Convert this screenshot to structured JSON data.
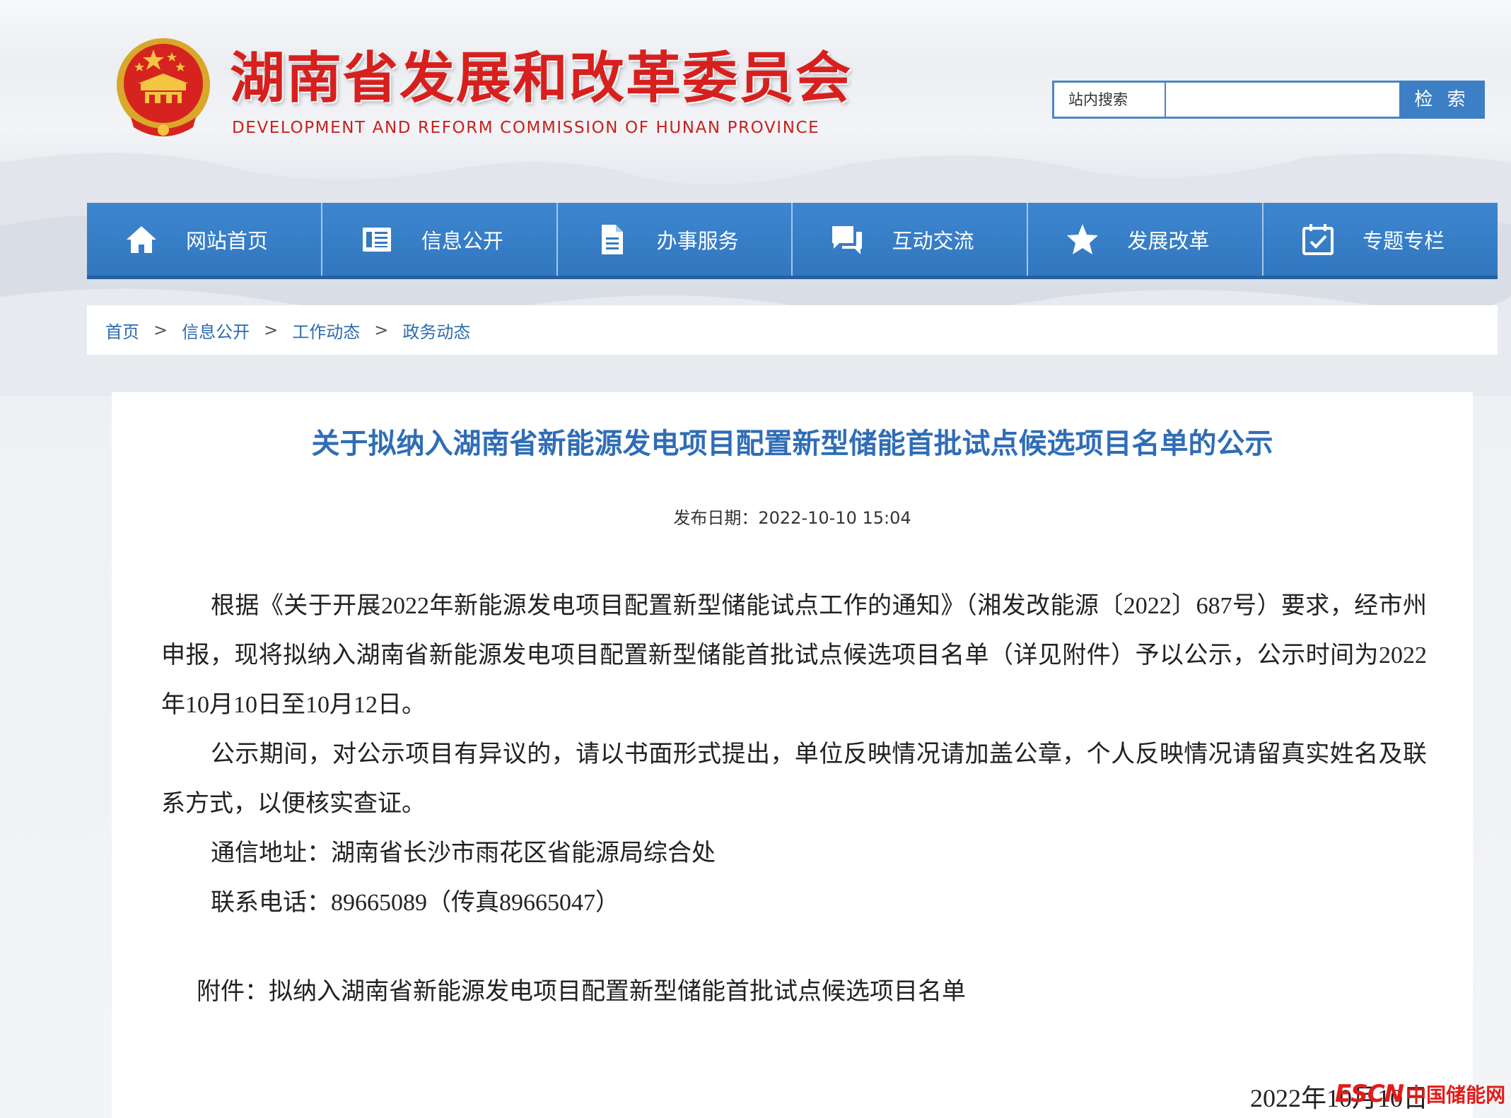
{
  "header": {
    "title": "湖南省发展和改革委员会",
    "subtitle": "DEVELOPMENT AND REFORM COMMISSION OF HUNAN PROVINCE",
    "search": {
      "label": "站内搜索",
      "value": "",
      "button": "检 索"
    }
  },
  "nav": {
    "items": [
      {
        "label": "网站首页",
        "icon": "home-icon"
      },
      {
        "label": "信息公开",
        "icon": "info-list-icon"
      },
      {
        "label": "办事服务",
        "icon": "document-icon"
      },
      {
        "label": "互动交流",
        "icon": "chat-icon"
      },
      {
        "label": "发展改革",
        "icon": "star-icon"
      },
      {
        "label": "专题专栏",
        "icon": "calendar-check-icon"
      }
    ]
  },
  "breadcrumb": [
    "首页",
    "信息公开",
    "工作动态",
    "政务动态"
  ],
  "breadcrumb_separator": ">",
  "article": {
    "title": "关于拟纳入湖南省新能源发电项目配置新型储能首批试点候选项目名单的公示",
    "publish_date": "发布日期：2022-10-10 15:04",
    "paragraphs": [
      "根据《关于开展2022年新能源发电项目配置新型储能试点工作的通知》（湘发改能源〔2022〕687号）要求，经市州申报，现将拟纳入湖南省新能源发电项目配置新型储能首批试点候选项目名单（详见附件）予以公示，公示时间为2022年10月10日至10月12日。",
      "公示期间，对公示项目有异议的，请以书面形式提出，单位反映情况请加盖公章，个人反映情况请留真实姓名及联系方式，以便核实查证。",
      "通信地址：湖南省长沙市雨花区省能源局综合处",
      "联系电话：89665089（传真89665047）"
    ],
    "attachment": "附件：拟纳入湖南省新能源发电项目配置新型储能首批试点候选项目名单",
    "sign_date": "2022年10月10日"
  },
  "watermark": {
    "brand": "ESCN",
    "name": "中国储能网"
  },
  "colors": {
    "brand_red": "#d7201e",
    "nav_blue": "#3379c0",
    "title_blue": "#2f6db6"
  }
}
